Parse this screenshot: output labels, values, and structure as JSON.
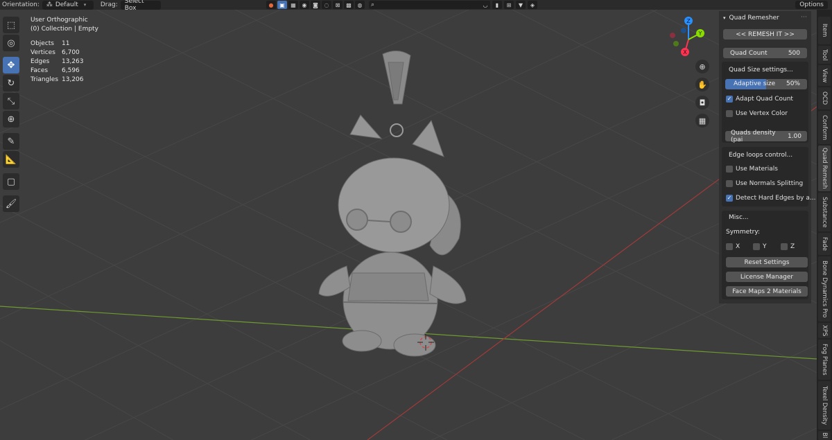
{
  "header": {
    "orientation_label": "Orientation:",
    "orientation_value": "Default",
    "drag_label": "Drag:",
    "drag_value": "Select Box",
    "options_label": "Options"
  },
  "viewport": {
    "view_name": "User Orthographic",
    "collection": "(0) Collection | Empty",
    "stats": [
      {
        "label": "Objects",
        "value": "11"
      },
      {
        "label": "Vertices",
        "value": "6,700"
      },
      {
        "label": "Edges",
        "value": "13,263"
      },
      {
        "label": "Faces",
        "value": "6,596"
      },
      {
        "label": "Triangles",
        "value": "13,206"
      }
    ],
    "gizmo": {
      "x": "X",
      "y": "Y",
      "z": "Z"
    }
  },
  "quad_remesher": {
    "panel_title": "Quad Remesher",
    "remesh_button": "<<  REMESH IT  >>",
    "quad_count_label": "Quad Count",
    "quad_count_value": "500",
    "quad_size_title": "Quad Size settings...",
    "adaptive_size_label": "Adaptive size",
    "adaptive_size_value": "50%",
    "adaptive_size_fraction": 0.5,
    "adapt_quad_count": {
      "label": "Adapt Quad Count",
      "checked": true
    },
    "use_vertex_color": {
      "label": "Use Vertex Color",
      "checked": false
    },
    "quads_density_label": "Quads density (pai",
    "quads_density_value": "1.00",
    "edge_loops_title": "Edge loops control...",
    "use_materials": {
      "label": "Use Materials",
      "checked": false
    },
    "use_normals_splitting": {
      "label": "Use Normals Splitting",
      "checked": false
    },
    "detect_hard_edges": {
      "label": "Detect Hard Edges by a...",
      "checked": true
    },
    "misc_title": "Misc...",
    "symmetry_label": "Symmetry:",
    "sym_x": "X",
    "sym_y": "Y",
    "sym_z": "Z",
    "reset_settings": "Reset Settings",
    "license_manager": "License Manager",
    "face_maps": "Face Maps 2 Materials"
  },
  "tabs": [
    "Item",
    "Tool",
    "View",
    "OCD",
    "Conform",
    "Quad Remesh",
    "Substance",
    "Fade",
    "Bone Dynamics Pro",
    "XPS",
    "Fog Planes",
    "Texel Density",
    "Bl"
  ],
  "active_tab": "Quad Remesh",
  "colors": {
    "accent": "#4772b3",
    "x_axis": "#ff3352",
    "y_axis": "#8bdc00",
    "z_axis": "#2890ff"
  }
}
